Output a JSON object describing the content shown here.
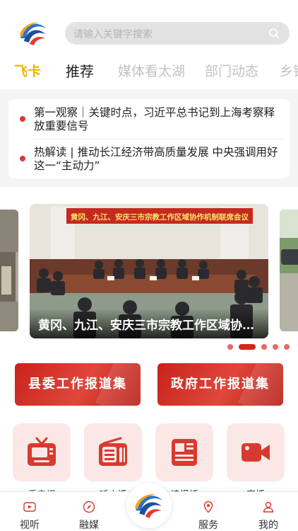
{
  "header": {
    "search_placeholder": "请输入关键字搜索"
  },
  "tabs": [
    {
      "label": "飞卡"
    },
    {
      "label": "推荐"
    },
    {
      "label": "媒体看太湖"
    },
    {
      "label": "部门动态"
    },
    {
      "label": "乡镇"
    }
  ],
  "news": [
    {
      "text": "第一观察｜关键时点，习近平总书记到上海考察释放重要信号"
    },
    {
      "text": "热解读 | 推动长江经济带高质量发展 中央强调用好这一“主动力”"
    }
  ],
  "carousel": {
    "banner_sign": "黄冈、九江、安庆三市宗教工作区域协作机制联席会议",
    "caption": "黄冈、九江、安庆三市宗教工作区域协作机制联席会议",
    "slide_count": 5,
    "active_index": 1
  },
  "banners": [
    {
      "label": "县委工作报道集"
    },
    {
      "label": "政府工作报道集"
    }
  ],
  "grid": [
    {
      "label": "看电视",
      "icon": "tv-icon"
    },
    {
      "label": "听广播",
      "icon": "radio-icon"
    },
    {
      "label": "读报纸",
      "icon": "newspaper-icon"
    },
    {
      "label": "直播",
      "icon": "video-camera-icon"
    }
  ],
  "nav": [
    {
      "label": "视听",
      "icon": "video-icon"
    },
    {
      "label": "融媒",
      "icon": "compass-icon"
    },
    {
      "label": "服务",
      "icon": "location-icon"
    },
    {
      "label": "我的",
      "icon": "user-icon"
    }
  ],
  "colors": {
    "accent_red": "#d4261c",
    "tab_active": "#f0b300",
    "tile_bg": "#fbe8e6"
  }
}
